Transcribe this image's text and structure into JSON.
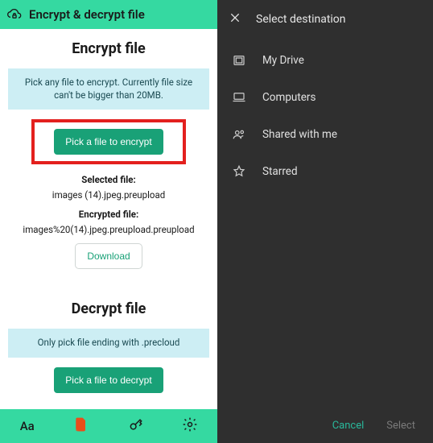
{
  "left": {
    "header": {
      "title": "Encrypt & decrypt file"
    },
    "encrypt": {
      "title": "Encrypt file",
      "info": "Pick any file to encrypt. Currently file size can't be bigger than 20MB.",
      "pick_button": "Pick a file to encrypt",
      "selected_label": "Selected file:",
      "selected_value": "images (14).jpeg.preupload",
      "encrypted_label": "Encrypted file:",
      "encrypted_value": "images%20(14).jpeg.preupload.preupload",
      "download": "Download"
    },
    "decrypt": {
      "title": "Decrypt file",
      "info": "Only pick file ending with .precloud",
      "pick_button": "Pick a file to decrypt"
    },
    "nav": {
      "text_tool": "Aa",
      "files": "files-icon",
      "key": "key-icon",
      "settings": "gear-icon"
    }
  },
  "right": {
    "title": "Select destination",
    "items": [
      {
        "icon": "drive-icon",
        "label": "My Drive"
      },
      {
        "icon": "laptop-icon",
        "label": "Computers"
      },
      {
        "icon": "people-icon",
        "label": "Shared with me"
      },
      {
        "icon": "star-icon",
        "label": "Starred"
      }
    ],
    "cancel": "Cancel",
    "select": "Select"
  },
  "colors": {
    "accent_green": "#35d9a1",
    "button_green": "#19a177",
    "highlight_red": "#e3201e",
    "info_bg": "#cdeef4",
    "dark_bg": "#2f2f2f",
    "teal_text": "#29b89b"
  }
}
